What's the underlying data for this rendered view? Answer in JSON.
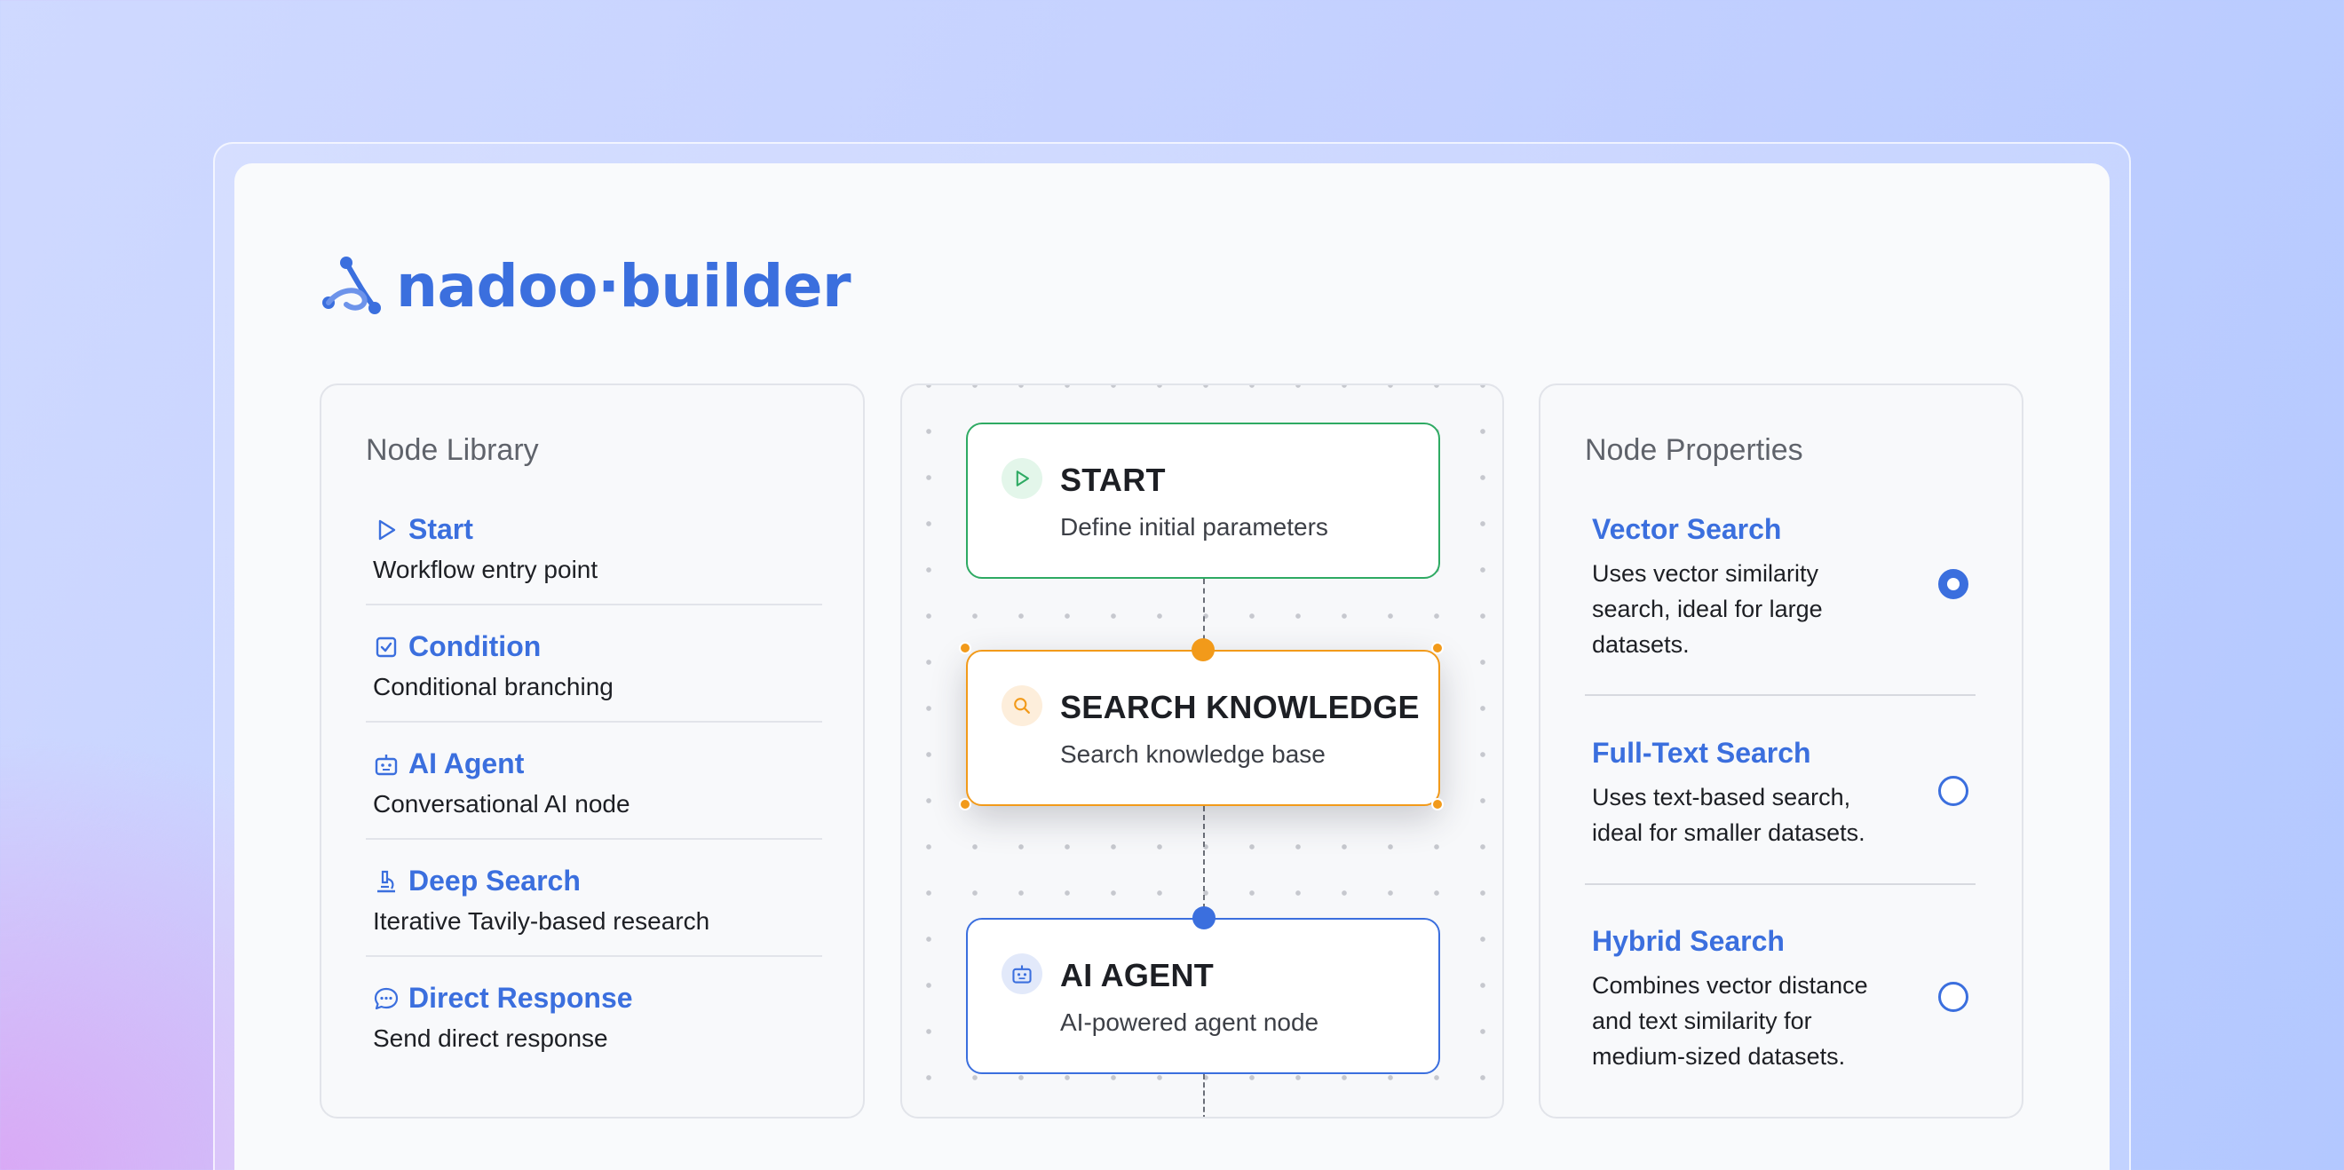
{
  "brand": {
    "name": "nadoo·builder",
    "color": "#3b6fde"
  },
  "library": {
    "title": "Node Library",
    "items": [
      {
        "name": "Start",
        "desc": "Workflow entry point",
        "icon": "play-icon"
      },
      {
        "name": "Condition",
        "desc": "Conditional branching",
        "icon": "checkbox-icon"
      },
      {
        "name": "AI Agent",
        "desc": "Conversational AI node",
        "icon": "robot-icon"
      },
      {
        "name": "Deep Search",
        "desc": "Iterative Tavily-based research",
        "icon": "microscope-icon"
      },
      {
        "name": "Direct Response",
        "desc": "Send direct response",
        "icon": "chat-bubble-icon"
      }
    ]
  },
  "canvas": {
    "nodes": [
      {
        "title": "START",
        "desc": "Define initial parameters",
        "icon": "play-icon",
        "color": "#2eaa63"
      },
      {
        "title": "SEARCH KNOWLEDGE",
        "desc": "Search knowledge base",
        "icon": "search-icon",
        "color": "#f29a1a"
      },
      {
        "title": "AI AGENT",
        "desc": "AI-powered agent node",
        "icon": "robot-icon",
        "color": "#3b6fde"
      }
    ]
  },
  "properties": {
    "title": "Node Properties",
    "options": [
      {
        "name": "Vector Search",
        "desc": "Uses vector similarity search, ideal for large datasets.",
        "selected": true
      },
      {
        "name": "Full-Text Search",
        "desc": "Uses text-based search, ideal for smaller datasets.",
        "selected": false
      },
      {
        "name": "Hybrid Search",
        "desc": "Combines vector distance and text similarity for medium-sized datasets.",
        "selected": false
      }
    ]
  }
}
